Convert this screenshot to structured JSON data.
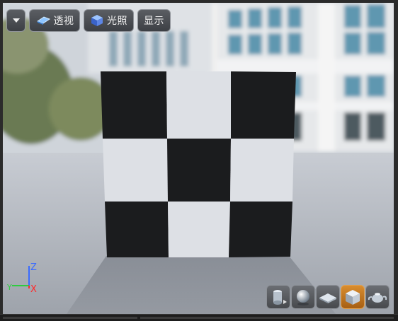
{
  "toolbar": {
    "menu_icon": "caret-down-icon",
    "perspective_label": "透视",
    "perspective_icon": "perspective-icon",
    "lighting_label": "光照",
    "lighting_icon": "lit-cube-icon",
    "show_label": "显示"
  },
  "axis_gizmo": {
    "z_label": "Z",
    "y_label": "Y",
    "x_label": "X",
    "z_color": "#3a6bff",
    "y_color": "#2ecc40",
    "x_color": "#ff2a2a"
  },
  "checkerboard": {
    "rows": 3,
    "cols": 3,
    "pattern": [
      [
        "dark",
        "light",
        "dark"
      ],
      [
        "light",
        "dark",
        "light"
      ],
      [
        "dark",
        "light",
        "dark"
      ]
    ],
    "dark_color": "#1b1c1e",
    "light_color": "#dde0e5"
  },
  "view_modes": [
    {
      "name": "cylinder-mode-icon",
      "active": false
    },
    {
      "name": "sphere-mode-icon",
      "active": false
    },
    {
      "name": "plane-mode-icon",
      "active": false
    },
    {
      "name": "cube-mode-icon",
      "active": true
    },
    {
      "name": "teapot-mode-icon",
      "active": false
    }
  ],
  "colors": {
    "accent": "#c7771f",
    "toolbar_bg": "#4a4d52"
  }
}
